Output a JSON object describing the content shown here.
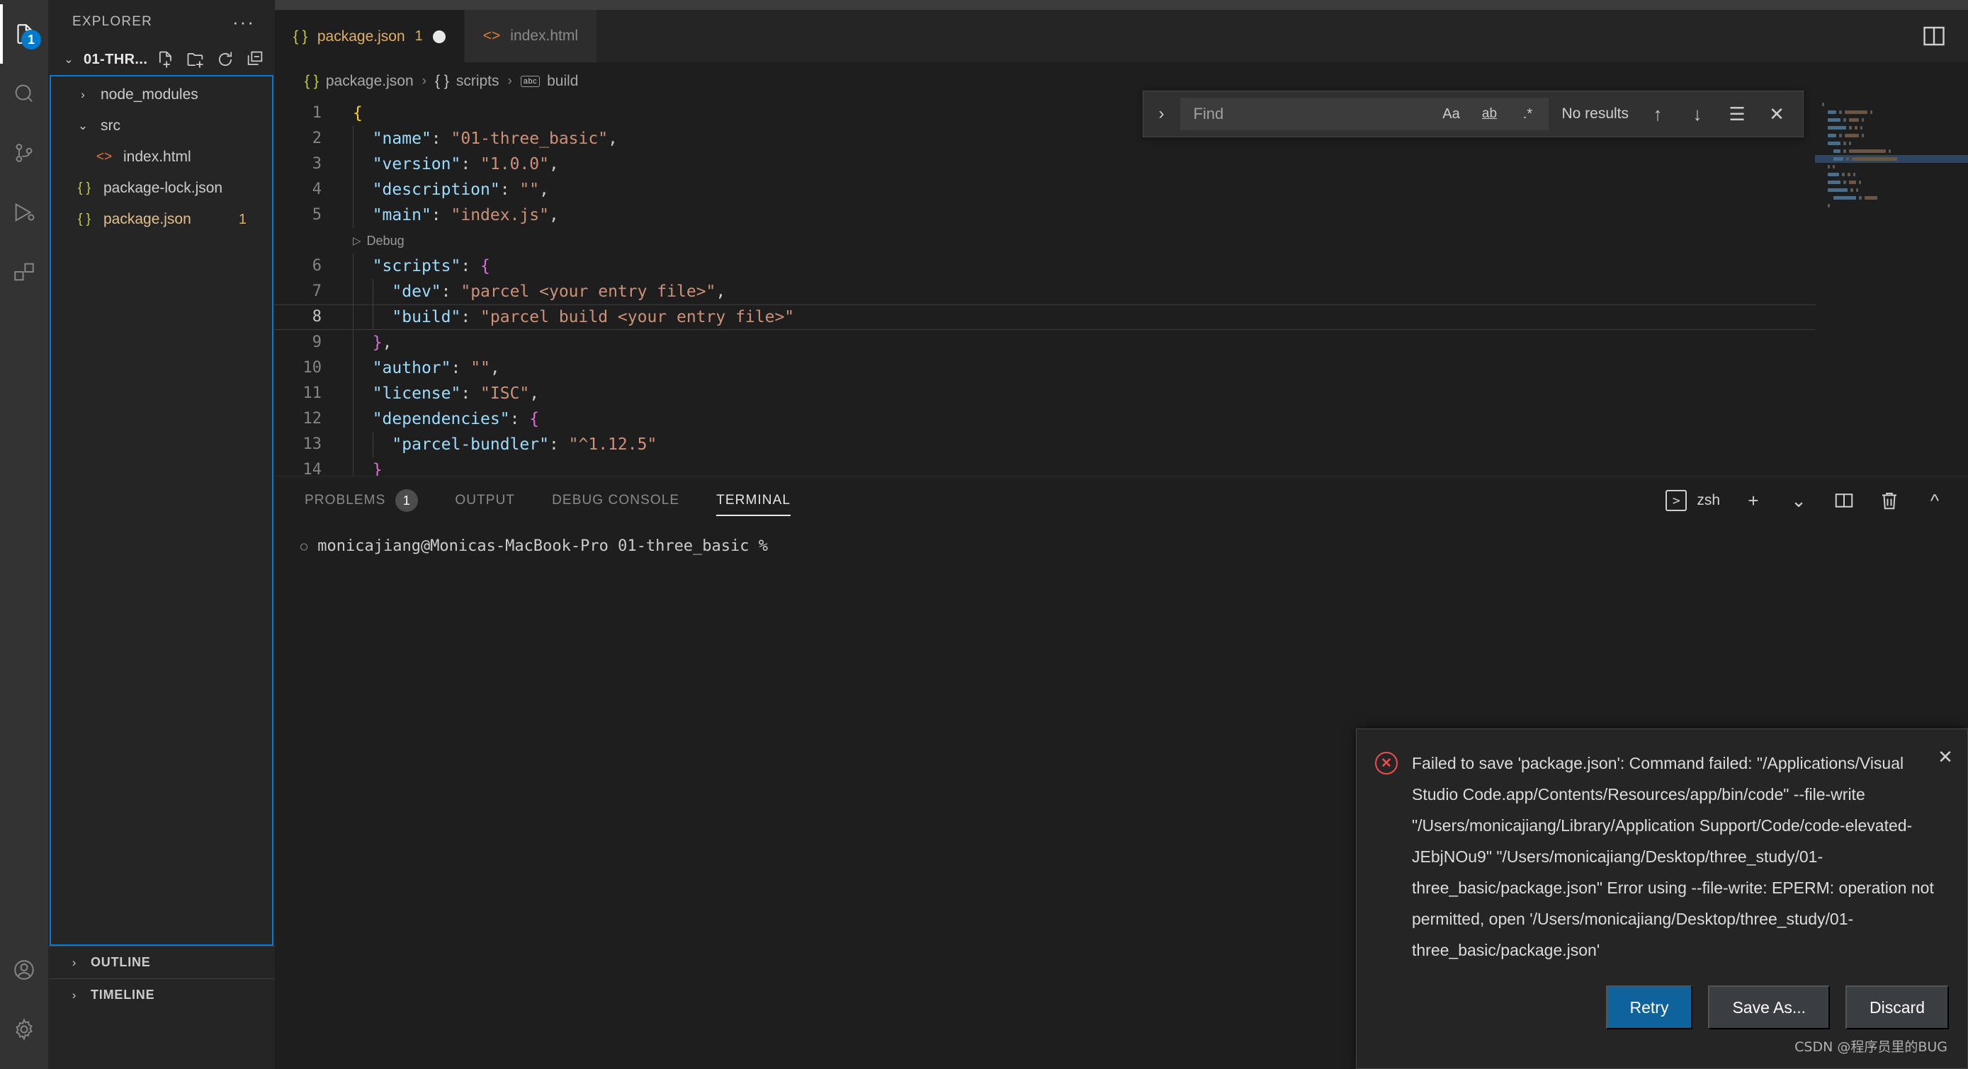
{
  "activitybar": {
    "items": [
      {
        "name": "explorer",
        "icon": "files-icon",
        "badge": "1",
        "active": true
      },
      {
        "name": "search",
        "icon": "search-icon",
        "badge": "",
        "active": false
      },
      {
        "name": "source-control",
        "icon": "source-control-icon",
        "badge": "",
        "active": false
      },
      {
        "name": "run-and-debug",
        "icon": "run-debug-icon",
        "badge": "",
        "active": false
      },
      {
        "name": "extensions",
        "icon": "extensions-icon",
        "badge": "",
        "active": false
      }
    ],
    "bottom": [
      {
        "name": "accounts",
        "icon": "account-icon"
      },
      {
        "name": "manage",
        "icon": "gear-icon"
      }
    ]
  },
  "sidebar": {
    "title": "EXPLORER",
    "more_label": "···",
    "folder": {
      "name": "01-THR...",
      "twisty": "⌄",
      "actions": [
        "new-file-icon",
        "new-folder-icon",
        "refresh-icon",
        "collapse-all-icon"
      ]
    },
    "files": [
      {
        "name": "node_modules",
        "type": "folder",
        "twisty": "›",
        "icon": "",
        "indent": 0,
        "count": ""
      },
      {
        "name": "src",
        "type": "folder",
        "twisty": "⌄",
        "icon": "",
        "indent": 0,
        "count": ""
      },
      {
        "name": "index.html",
        "type": "file",
        "twisty": "",
        "icon": "<>",
        "indent": 1,
        "count": ""
      },
      {
        "name": "package-lock.json",
        "type": "file",
        "twisty": "",
        "icon": "{ }",
        "indent": 0,
        "count": ""
      },
      {
        "name": "package.json",
        "type": "file",
        "twisty": "",
        "icon": "{ }",
        "indent": 0,
        "count": "1"
      }
    ],
    "sections": [
      {
        "label": "OUTLINE",
        "twisty": "›"
      },
      {
        "label": "TIMELINE",
        "twisty": "›"
      }
    ]
  },
  "tabs": [
    {
      "icon": "{ }",
      "label": "package.json",
      "error_count": "1",
      "dirty": true,
      "active": true
    },
    {
      "icon": "<>",
      "label": "index.html",
      "error_count": "",
      "dirty": false,
      "active": false
    }
  ],
  "tabs_actions": {
    "split_editor": "split-editor-icon"
  },
  "breadcrumb": [
    {
      "icon": "{ }",
      "label": "package.json"
    },
    {
      "icon": "{ }",
      "label": "scripts"
    },
    {
      "icon": "abc",
      "label": "build"
    }
  ],
  "editor": {
    "codelens": {
      "label": "Debug",
      "after_line": 5
    },
    "current_line": 8,
    "lines": [
      {
        "no": "1",
        "indent": 0,
        "tokens": [
          {
            "t": "{",
            "c": "br1"
          }
        ]
      },
      {
        "no": "2",
        "indent": 1,
        "tokens": [
          {
            "t": "\"name\"",
            "c": "key"
          },
          {
            "t": ": ",
            "c": "pun"
          },
          {
            "t": "\"01-three_basic\"",
            "c": "str"
          },
          {
            "t": ",",
            "c": "pun"
          }
        ]
      },
      {
        "no": "3",
        "indent": 1,
        "tokens": [
          {
            "t": "\"version\"",
            "c": "key"
          },
          {
            "t": ": ",
            "c": "pun"
          },
          {
            "t": "\"1.0.0\"",
            "c": "str"
          },
          {
            "t": ",",
            "c": "pun"
          }
        ]
      },
      {
        "no": "4",
        "indent": 1,
        "tokens": [
          {
            "t": "\"description\"",
            "c": "key"
          },
          {
            "t": ": ",
            "c": "pun"
          },
          {
            "t": "\"\"",
            "c": "str"
          },
          {
            "t": ",",
            "c": "pun"
          }
        ]
      },
      {
        "no": "5",
        "indent": 1,
        "tokens": [
          {
            "t": "\"main\"",
            "c": "key"
          },
          {
            "t": ": ",
            "c": "pun"
          },
          {
            "t": "\"index.js\"",
            "c": "str"
          },
          {
            "t": ",",
            "c": "pun"
          }
        ]
      },
      {
        "no": "6",
        "indent": 1,
        "tokens": [
          {
            "t": "\"scripts\"",
            "c": "key"
          },
          {
            "t": ": ",
            "c": "pun"
          },
          {
            "t": "{",
            "c": "br2"
          }
        ]
      },
      {
        "no": "7",
        "indent": 2,
        "tokens": [
          {
            "t": "\"dev\"",
            "c": "key"
          },
          {
            "t": ": ",
            "c": "pun"
          },
          {
            "t": "\"parcel <your entry file>\"",
            "c": "str"
          },
          {
            "t": ",",
            "c": "pun"
          }
        ]
      },
      {
        "no": "8",
        "indent": 2,
        "tokens": [
          {
            "t": "\"build\"",
            "c": "key"
          },
          {
            "t": ": ",
            "c": "pun"
          },
          {
            "t": "\"parcel build <your entry file>\"",
            "c": "str"
          }
        ]
      },
      {
        "no": "9",
        "indent": 1,
        "tokens": [
          {
            "t": "}",
            "c": "br2"
          },
          {
            "t": ",",
            "c": "pun"
          }
        ]
      },
      {
        "no": "10",
        "indent": 1,
        "tokens": [
          {
            "t": "\"author\"",
            "c": "key"
          },
          {
            "t": ": ",
            "c": "pun"
          },
          {
            "t": "\"\"",
            "c": "str"
          },
          {
            "t": ",",
            "c": "pun"
          }
        ]
      },
      {
        "no": "11",
        "indent": 1,
        "tokens": [
          {
            "t": "\"license\"",
            "c": "key"
          },
          {
            "t": ": ",
            "c": "pun"
          },
          {
            "t": "\"ISC\"",
            "c": "str"
          },
          {
            "t": ",",
            "c": "pun"
          }
        ]
      },
      {
        "no": "12",
        "indent": 1,
        "tokens": [
          {
            "t": "\"dependencies\"",
            "c": "key"
          },
          {
            "t": ": ",
            "c": "pun"
          },
          {
            "t": "{",
            "c": "br2"
          }
        ]
      },
      {
        "no": "13",
        "indent": 2,
        "tokens": [
          {
            "t": "\"parcel-bundler\"",
            "c": "key"
          },
          {
            "t": ": ",
            "c": "pun"
          },
          {
            "t": "\"^1.12.5\"",
            "c": "str"
          }
        ]
      },
      {
        "no": "14",
        "indent": 1,
        "tokens": [
          {
            "t": "}",
            "c": "br2"
          }
        ]
      }
    ]
  },
  "find": {
    "toggle_icon": "chevron-right-icon",
    "placeholder": "Find",
    "value": "",
    "options": [
      {
        "name": "match-case",
        "label": "Aa"
      },
      {
        "name": "match-whole-word",
        "label": "ab"
      },
      {
        "name": "use-regex",
        "label": ".*"
      }
    ],
    "result_text": "No results",
    "buttons": [
      {
        "name": "previous-match",
        "glyph": "↑"
      },
      {
        "name": "next-match",
        "glyph": "↓"
      },
      {
        "name": "find-in-selection",
        "glyph": "☰"
      },
      {
        "name": "close-find",
        "glyph": "✕"
      }
    ]
  },
  "panel": {
    "tabs": [
      {
        "label": "PROBLEMS",
        "badge": "1",
        "active": false
      },
      {
        "label": "OUTPUT",
        "badge": "",
        "active": false
      },
      {
        "label": "DEBUG CONSOLE",
        "badge": "",
        "active": false
      },
      {
        "label": "TERMINAL",
        "badge": "",
        "active": true
      }
    ],
    "shell": "zsh",
    "actions": [
      {
        "name": "new-terminal-button",
        "glyph": "+"
      },
      {
        "name": "terminal-dropdown-button",
        "glyph": "⌄"
      },
      {
        "name": "split-terminal-button",
        "glyph": "◫"
      },
      {
        "name": "kill-terminal-button",
        "glyph": "Ὕ1"
      },
      {
        "name": "collapse-panel-button",
        "glyph": "⌃"
      }
    ],
    "terminal_prompt": "monicajiang@Monicas-MacBook-Pro 01-three_basic %"
  },
  "notification": {
    "icon": "error-icon",
    "message": "Failed to save 'package.json': Command failed: \"/Applications/Visual Studio Code.app/Contents/Resources/app/bin/code\" --file-write \"/Users/monicajiang/Library/Application Support/Code/code-elevated-JEbjNOu9\" \"/Users/monicajiang/Desktop/three_study/01-three_basic/package.json\" Error using --file-write: EPERM: operation not permitted, open '/Users/monicajiang/Desktop/three_study/01-three_basic/package.json'",
    "close_glyph": "✕",
    "buttons": [
      {
        "label": "Retry",
        "primary": true
      },
      {
        "label": "Save As...",
        "primary": false
      },
      {
        "label": "Discard",
        "primary": false
      }
    ],
    "watermark": "CSDN @程序员里的BUG"
  },
  "colors": {
    "accent": "#007acc",
    "error": "#f14c4c",
    "primary_button": "#0e639c",
    "selection_border": "#0a79d6",
    "json_key": "#9cdcfe",
    "json_string": "#ce9178"
  }
}
